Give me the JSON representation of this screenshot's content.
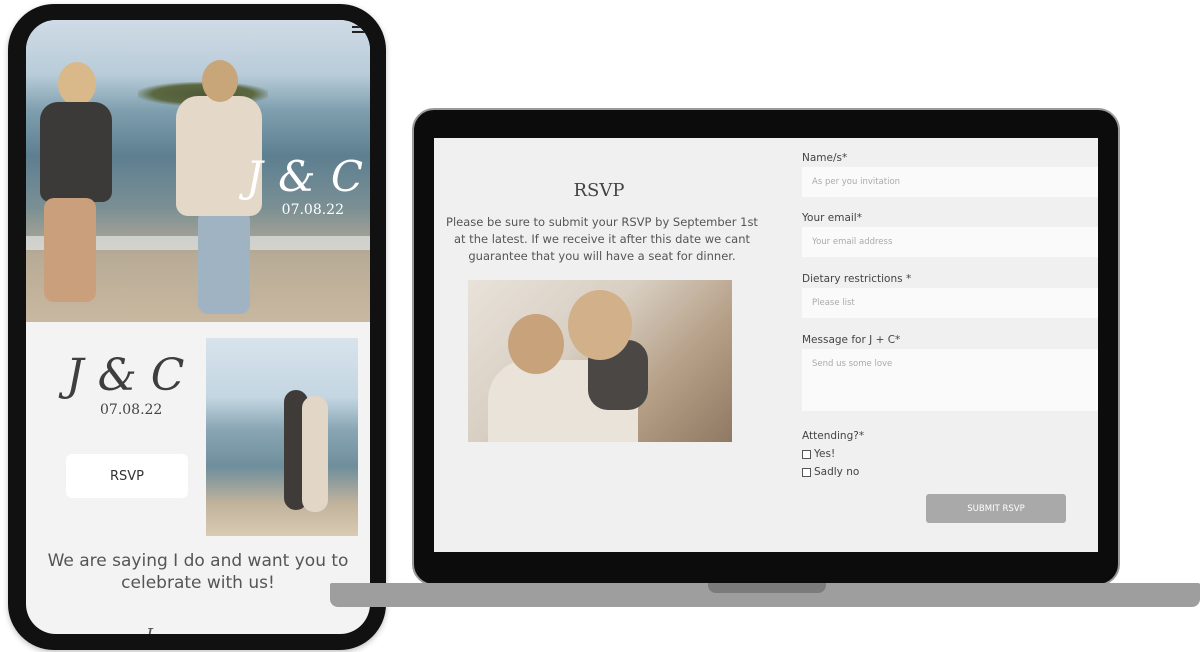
{
  "phone": {
    "hero_monogram": "J & C",
    "hero_date": "07.08.22",
    "monogram": "J & C",
    "date": "07.08.22",
    "rsvp_button": "RSVP",
    "tagline": "We are saying I do and want you to celebrate with us!",
    "cutoff_text": "I",
    "menu_icon": "hamburger-icon"
  },
  "laptop": {
    "rsvp_title": "RSVP",
    "rsvp_text": "Please be sure to submit your RSVP by September 1st at the latest. If we receive it after this date we cant guarantee that you will have a seat for dinner.",
    "form": {
      "name_label": "Name/s*",
      "name_placeholder": "As per you invitation",
      "email_label": "Your email*",
      "email_placeholder": "Your email address",
      "dietary_label": "Dietary restrictions *",
      "dietary_placeholder": "Please list",
      "message_label": "Message for J + C*",
      "message_placeholder": "Send us some love",
      "attending_label": "Attending?*",
      "option_yes": "Yes!",
      "option_no": "Sadly no",
      "submit_label": "SUBMIT RSVP"
    }
  },
  "colors": {
    "page_bg": "#f0f0f0",
    "submit_bg": "#a9a9a9",
    "device_frame": "#111111"
  }
}
